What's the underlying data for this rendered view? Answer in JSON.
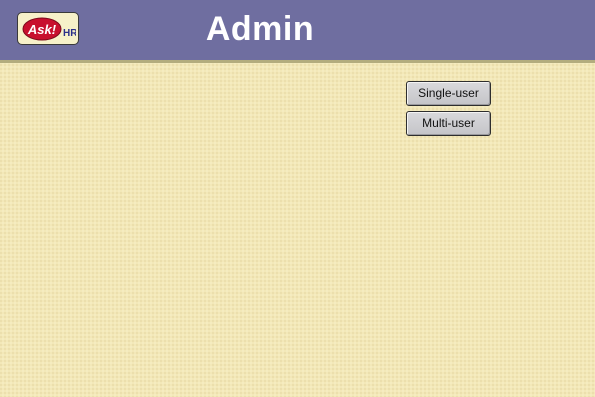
{
  "header": {
    "title": "Admin",
    "background_color": "#6f6ea0",
    "logo": {
      "text_primary": "Ask!",
      "text_secondary": "HR",
      "primary_color": "#c8102e",
      "secondary_color": "#2b2f8a"
    }
  },
  "main": {
    "background_color": "#f3e8b8",
    "buttons": [
      {
        "label": "Single-user"
      },
      {
        "label": "Multi-user"
      }
    ]
  }
}
